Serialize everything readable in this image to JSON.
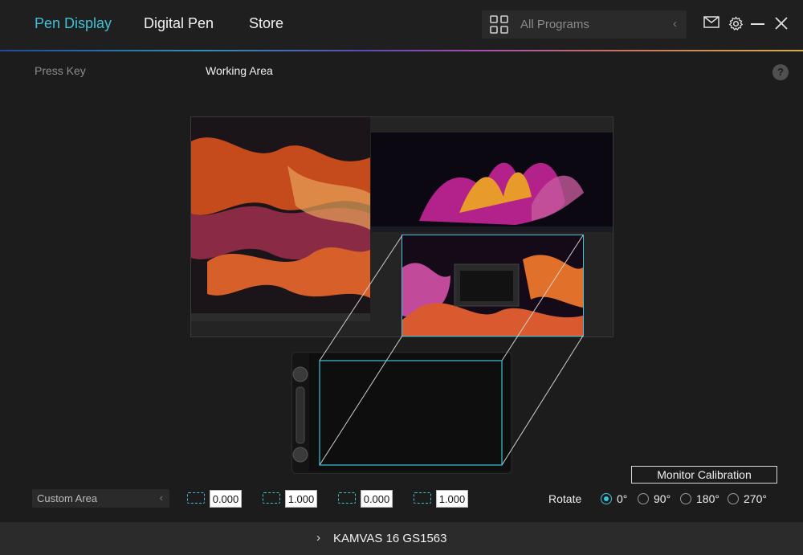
{
  "header": {
    "tabs": [
      {
        "label": "Pen Display",
        "active": true
      },
      {
        "label": "Digital Pen",
        "active": false
      },
      {
        "label": "Store",
        "active": false
      }
    ],
    "search": {
      "placeholder": "All Programs"
    }
  },
  "subtabs": {
    "press_key": "Press Key",
    "working_area": "Working Area"
  },
  "help": "?",
  "area": {
    "mode": "Custom Area",
    "values": [
      "0.000",
      "1.000",
      "0.000",
      "1.000"
    ]
  },
  "calibration_button": "Monitor Calibration",
  "rotate": {
    "label": "Rotate",
    "options": [
      "0°",
      "90°",
      "180°",
      "270°"
    ],
    "selected": "0°"
  },
  "device": "KAMVAS 16 GS1563",
  "colors": {
    "accent": "#3ec3d9",
    "background": "#1c1c1c"
  }
}
